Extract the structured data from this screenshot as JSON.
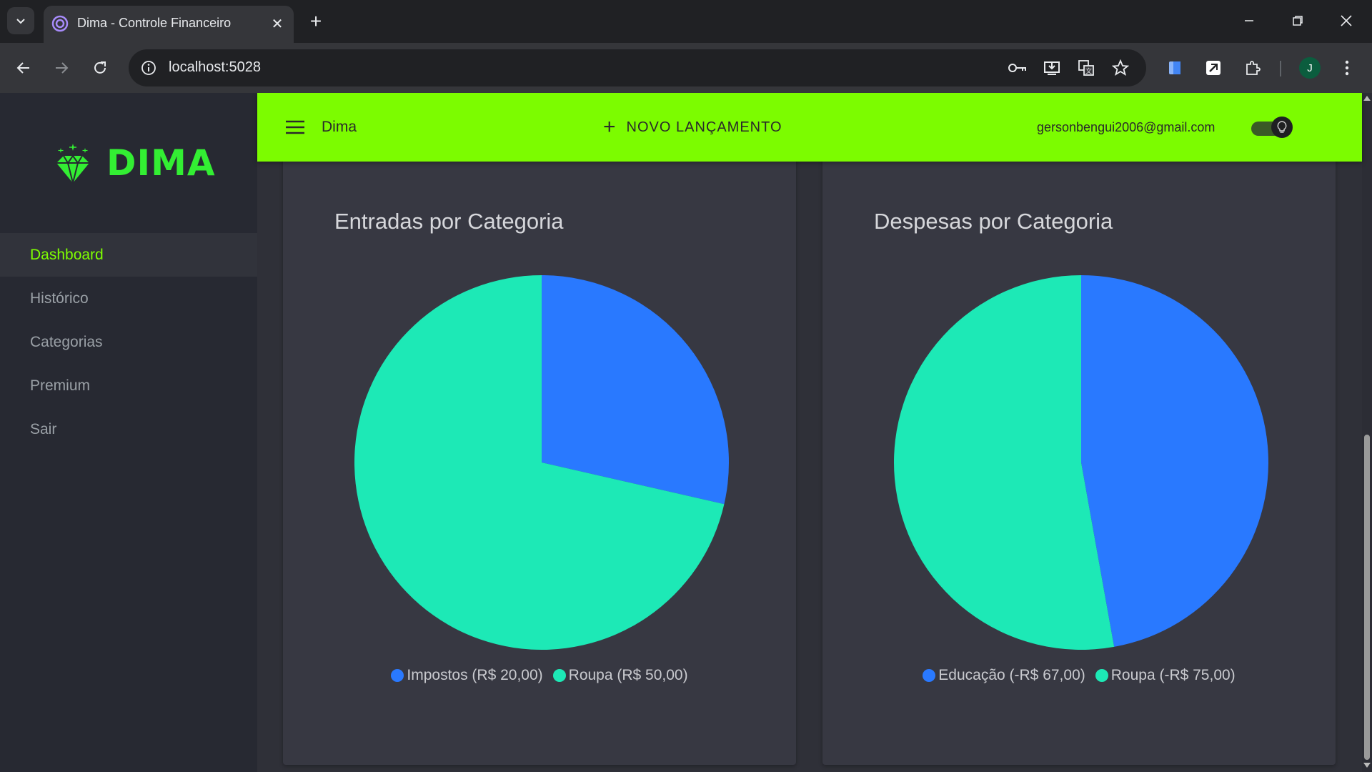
{
  "browser": {
    "tab_title": "Dima - Controle Financeiro",
    "url": "localhost:5028",
    "profile_initial": "J",
    "icons": [
      "tab-search-icon",
      "app-favicon-icon",
      "close-icon",
      "plus-icon",
      "minimize-icon",
      "restore-icon",
      "close-window-icon",
      "back-icon",
      "forward-icon",
      "reload-icon",
      "info-icon",
      "key-icon",
      "install-icon",
      "translate-icon",
      "star-icon",
      "extension-icon",
      "puzzle-icon",
      "more-vert-icon"
    ]
  },
  "sidebar": {
    "logo_text": "DIMA",
    "items": [
      {
        "label": "Dashboard",
        "active": true
      },
      {
        "label": "Histórico",
        "active": false
      },
      {
        "label": "Categorias",
        "active": false
      },
      {
        "label": "Premium",
        "active": false
      },
      {
        "label": "Sair",
        "active": false
      }
    ]
  },
  "appbar": {
    "brand": "Dima",
    "new_entry_label": "NOVO LANÇAMENTO",
    "user_email": "gersonbengui2006@gmail.com",
    "dark_mode_on": true,
    "accent_color": "#7cfc00"
  },
  "charts": {
    "income": {
      "title": "Entradas por Categoria"
    },
    "expense": {
      "title": "Despesas por Categoria"
    }
  },
  "chart_data": [
    {
      "type": "pie",
      "title": "Entradas por Categoria",
      "slices": [
        {
          "label": "Impostos (R$ 20,00)",
          "value": 20,
          "color": "#2979ff"
        },
        {
          "label": "Roupa (R$ 50,00)",
          "value": 50,
          "color": "#1de9b6"
        }
      ],
      "legend": "bottom"
    },
    {
      "type": "pie",
      "title": "Despesas por Categoria",
      "slices": [
        {
          "label": "Educação (-R$ 67,00)",
          "value": 67,
          "color": "#2979ff"
        },
        {
          "label": "Roupa (-R$ 75,00)",
          "value": 75,
          "color": "#1de9b6"
        }
      ],
      "legend": "bottom"
    }
  ]
}
